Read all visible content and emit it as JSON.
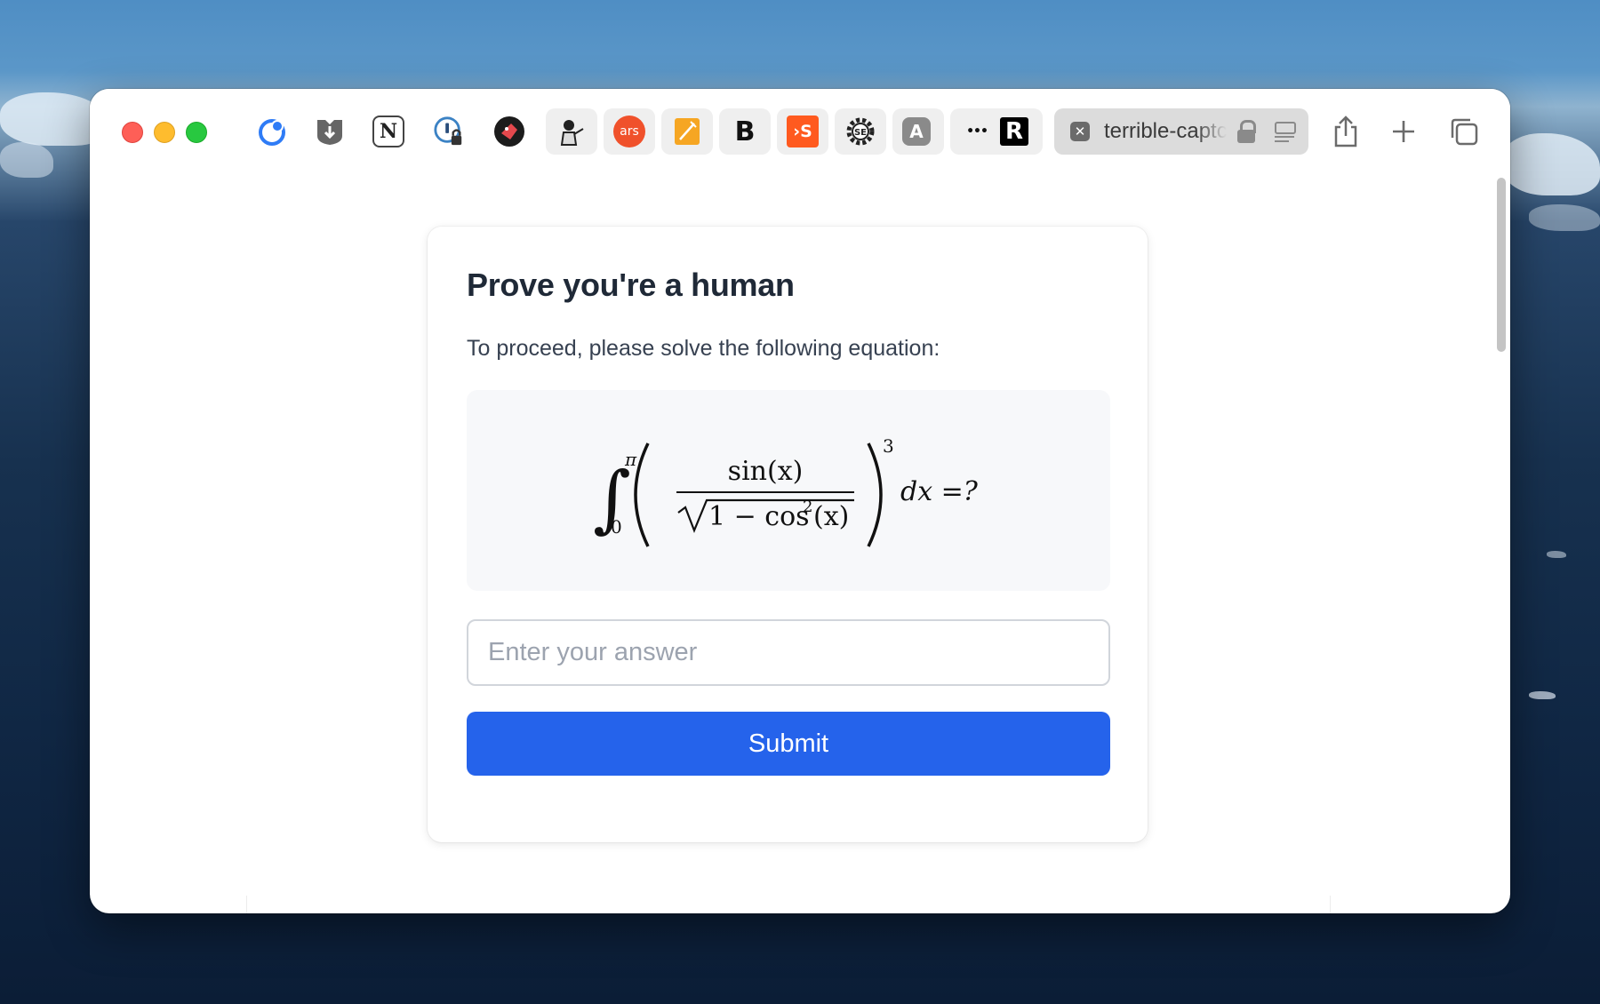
{
  "browser": {
    "tab": {
      "title": "terrible-captcha",
      "close_icon": "close-icon",
      "lock_icon": "lock-icon",
      "reader_icon": "reader-icon"
    },
    "traffic_lights": {
      "close": "#fe5f57",
      "minimize": "#febc2e",
      "zoom": "#28c840"
    },
    "favorites": [
      {
        "name": "crescent-ring-icon",
        "label": ""
      },
      {
        "name": "download-shield-icon",
        "label": ""
      },
      {
        "name": "notion-icon",
        "label": "N"
      },
      {
        "name": "password-lock-icon",
        "label": ""
      },
      {
        "name": "red-bird-icon",
        "label": ""
      },
      {
        "name": "cartoon-figure-icon",
        "label": ""
      },
      {
        "name": "ars-icon",
        "label": "ars"
      },
      {
        "name": "orange-notebook-icon",
        "label": ""
      },
      {
        "name": "bold-b-icon",
        "label": "B"
      },
      {
        "name": "substack-icon",
        "label": "›S"
      },
      {
        "name": "se-gear-icon",
        "label": "SE"
      },
      {
        "name": "letter-a-icon",
        "label": "A"
      },
      {
        "name": "dots-icon",
        "label": "•••"
      },
      {
        "name": "r-logo-icon",
        "label": "R"
      }
    ],
    "toolbar_icons": [
      "share-icon",
      "new-tab-icon",
      "tab-overview-icon"
    ]
  },
  "page": {
    "heading": "Prove you're a human",
    "instruction": "To proceed, please solve the following equation:",
    "equation": {
      "integral_sign": "∫",
      "upper_limit": "π",
      "lower_limit": "0",
      "numerator": "sin(x)",
      "radicand_start": "1 − cos",
      "radicand_power": "2",
      "radicand_end": "(x)",
      "outer_exponent": "3",
      "suffix": "dx =?"
    },
    "answer": {
      "placeholder": "Enter your answer",
      "value": ""
    },
    "submit_label": "Submit"
  },
  "colors": {
    "accent": "#2563eb",
    "heading": "#1f2937",
    "text": "#374151",
    "equation_bg": "#f7f8fa"
  }
}
